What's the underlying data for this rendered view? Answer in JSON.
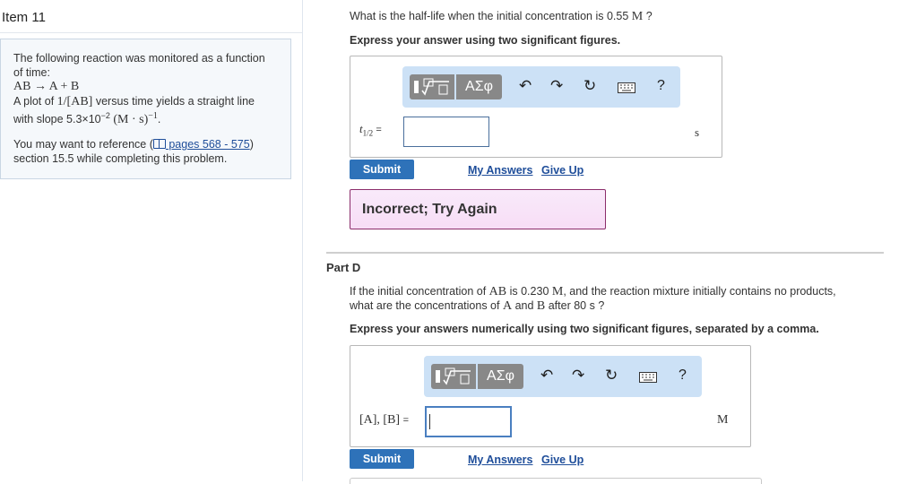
{
  "item": {
    "title": "Item 11"
  },
  "intro": {
    "line1": "The following reaction was monitored as a function",
    "line2": "of time:",
    "reaction": "AB → A + B",
    "plot_prefix": "A plot of",
    "plot_math": "1/[AB]",
    "plot_suffix": "versus time yields a straight line",
    "slope_text": "with slope 5.3×10",
    "slope_exp": "−2",
    "slope_units": "(M · s)",
    "slope_units_exp": "−1",
    "slope_end": ".",
    "ref_prefix": "You may want to reference (",
    "ref_link": " pages 568 - 575",
    "ref_suffix": ")",
    "ref_line2": "section 15.5 while completing this problem."
  },
  "partC": {
    "question_prefix": "What is the half-life when the initial concentration is 0.55",
    "question_unit": "M",
    "question_suffix": " ?",
    "instruction": "Express your answer using two significant figures.",
    "var_label": "t",
    "var_sub": "1/2",
    "equals": "=",
    "input_value": "",
    "unit": "s",
    "feedback": "Incorrect; Try Again"
  },
  "partD": {
    "heading": "Part D",
    "question_line1_a": "If the initial concentration of",
    "question_line1_b": "AB",
    "question_line1_c": "is 0.230",
    "question_line1_d": "M",
    "question_line1_e": ", and the reaction mixture initially contains no products,",
    "question_line2_a": "what are the concentrations of",
    "question_line2_b": "A",
    "question_line2_c": "and",
    "question_line2_d": "B",
    "question_line2_e": "after 80",
    "question_line2_f": "s ?",
    "instruction": "Express your answers numerically using two significant figures, separated by a comma.",
    "var_label": "[A], [B]",
    "equals": "=",
    "input_value": "",
    "unit": "M"
  },
  "toolbar": {
    "greek": "ΑΣφ",
    "help": "?"
  },
  "buttons": {
    "submit": "Submit",
    "my_answers": "My Answers",
    "give_up": "Give Up"
  }
}
